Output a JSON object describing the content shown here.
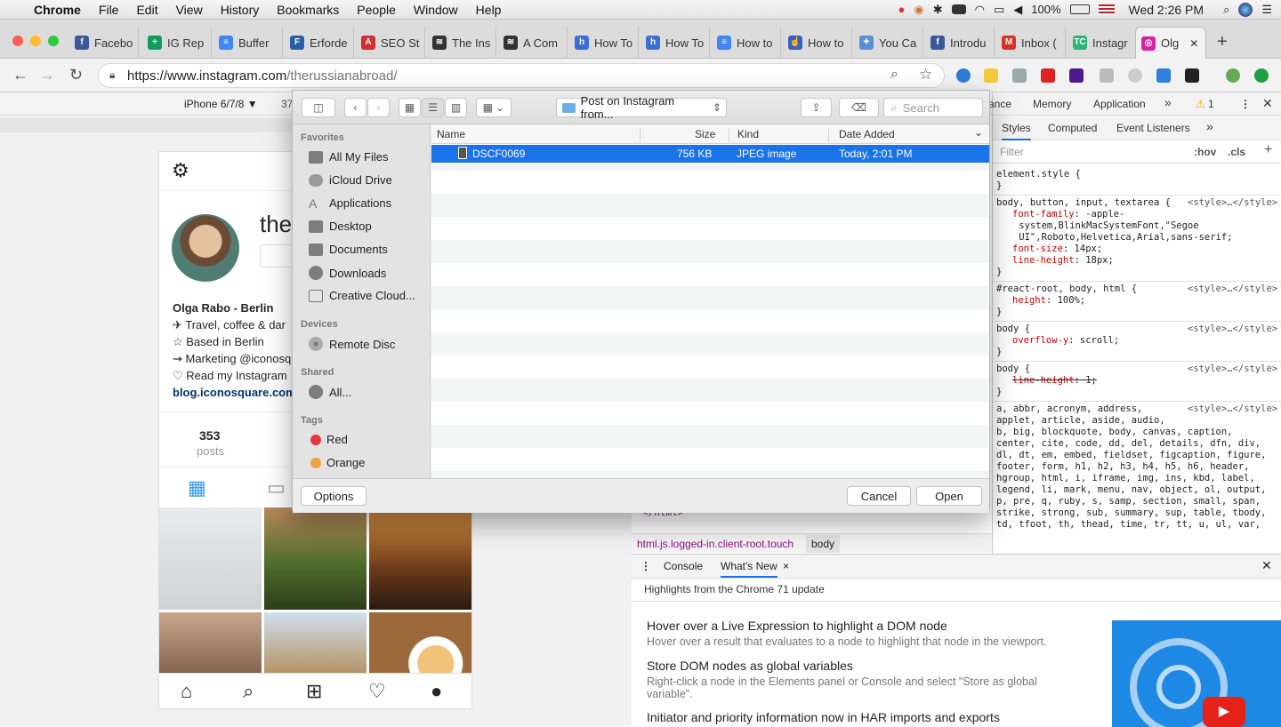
{
  "menubar": {
    "apple": "",
    "app": "Chrome",
    "items": [
      "File",
      "Edit",
      "View",
      "History",
      "Bookmarks",
      "People",
      "Window",
      "Help"
    ],
    "battery": "100%",
    "clock": "Wed 2:26 PM"
  },
  "tabs": [
    {
      "title": "Facebo",
      "color": "#3b5998",
      "glyph": "f"
    },
    {
      "title": "IG Rep",
      "color": "#0f9d58",
      "glyph": "+"
    },
    {
      "title": "Buffer",
      "color": "#4285f4",
      "glyph": "≡"
    },
    {
      "title": "Erforde",
      "color": "#2a5fa8",
      "glyph": "F"
    },
    {
      "title": "SEO St",
      "color": "#d32f2f",
      "glyph": "A"
    },
    {
      "title": "The Ins",
      "color": "#333333",
      "glyph": "≋"
    },
    {
      "title": "A Com",
      "color": "#333333",
      "glyph": "≋"
    },
    {
      "title": "How To",
      "color": "#3b6fd6",
      "glyph": "h"
    },
    {
      "title": "How To",
      "color": "#3b6fd6",
      "glyph": "h"
    },
    {
      "title": "How to",
      "color": "#4285f4",
      "glyph": "≡"
    },
    {
      "title": "How to",
      "color": "#3a5fbf",
      "glyph": "☝"
    },
    {
      "title": "You Ca",
      "color": "#5a8fd6",
      "glyph": "✦"
    },
    {
      "title": "Introdu",
      "color": "#3b5998",
      "glyph": "f"
    },
    {
      "title": "Inbox (",
      "color": "#d93025",
      "glyph": "M"
    },
    {
      "title": "Instagr",
      "color": "#2bb673",
      "glyph": "TC"
    },
    {
      "title": "Olg",
      "color": "#d6249f",
      "glyph": "◎",
      "active": true
    }
  ],
  "url": {
    "host": "https://www.instagram.com",
    "path": "/therussianabroad/"
  },
  "device_toolbar": {
    "device": "iPhone 6/7/8 ▼",
    "width": "37"
  },
  "instagram": {
    "name_partial": "the",
    "bio_name": "Olga Rabo - Berlin",
    "bio_lines": [
      "✈ Travel, coffee & dar",
      "☆ Based in Berlin",
      "⇝ Marketing @iconosq",
      "♡ Read my Instagram"
    ],
    "bio_mention": "@iconosq",
    "bio_link": "blog.iconosquare.com",
    "posts_count": "353",
    "posts_label": "posts"
  },
  "dialog": {
    "location": "Post on Instagram from...",
    "search_placeholder": "Search",
    "sidebar": {
      "favorites_head": "Favorites",
      "favorites": [
        "All My Files",
        "iCloud Drive",
        "Applications",
        "Desktop",
        "Documents",
        "Downloads",
        "Creative Cloud..."
      ],
      "devices_head": "Devices",
      "devices": [
        "Remote Disc"
      ],
      "shared_head": "Shared",
      "shared": [
        "All..."
      ],
      "tags_head": "Tags",
      "tags": [
        {
          "name": "Red",
          "color": "#e5383b"
        },
        {
          "name": "Orange",
          "color": "#f4a23b"
        }
      ]
    },
    "columns": {
      "name": "Name",
      "size": "Size",
      "kind": "Kind",
      "date": "Date Added"
    },
    "files": [
      {
        "name": "DSCF0069",
        "size": "756 KB",
        "kind": "JPEG image",
        "date": "Today, 2:01 PM"
      }
    ],
    "options_btn": "Options",
    "cancel_btn": "Cancel",
    "open_btn": "Open"
  },
  "devtools": {
    "top_tabs": [
      "ance",
      "Memory",
      "Application",
      "»"
    ],
    "warnings": "1",
    "sub_tabs": [
      "Styles",
      "Computed",
      "Event Listeners",
      "»"
    ],
    "filter_placeholder": "Filter",
    "hov": ":hov",
    "cls": ".cls",
    "breadcrumb": [
      "html.js.logged-in.client-root.touch",
      "body"
    ],
    "html_tail": "</html>",
    "rules": [
      {
        "selector": "element.style {",
        "src": "",
        "props": [],
        "close": "}"
      },
      {
        "selector": "body, button, input, textarea {",
        "src": "<style>…</style>",
        "props": [
          [
            "font-family",
            " -apple-"
          ],
          [
            "",
            "    system,BlinkMacSystemFont,\"Segoe"
          ],
          [
            "",
            "    UI\",Roboto,Helvetica,Arial,sans-serif;"
          ],
          [
            "font-size",
            " 14px;"
          ],
          [
            "line-height",
            " 18px;"
          ]
        ],
        "close": "}"
      },
      {
        "selector": "#react-root, body, html {",
        "src": "<style>…</style>",
        "props": [
          [
            "height",
            " 100%;"
          ]
        ],
        "close": "}"
      },
      {
        "selector": "body {",
        "src": "<style>…</style>",
        "props": [
          [
            "overflow-y",
            " scroll;"
          ]
        ],
        "close": "}"
      },
      {
        "selector": "body {",
        "src": "<style>…</style>",
        "props": [
          [
            "line-height",
            " 1;"
          ]
        ],
        "close": "}"
      }
    ],
    "reset_rule": {
      "src": "<style>…</style>",
      "lines": [
        "a, abbr, acronym, address,",
        "applet, article, aside, audio,",
        "b, big, blockquote, body, canvas, caption,",
        "center, cite, code, dd, del, details, dfn, div,",
        "dl, dt, em, embed, fieldset, figcaption, figure,",
        "footer, form, h1, h2, h3, h4, h5, h6, header,",
        "hgroup, html, i, iframe, img, ins, kbd, label,",
        "legend, li, mark, menu, nav, object, ol, output,",
        "p, pre, q, ruby, s, samp, section, small, span,",
        "strike, strong, sub, summary, sup, table, tbody,",
        "td, tfoot, th, thead, time, tr, tt, u, ul, var,"
      ]
    },
    "drawer": {
      "tabs": [
        "Console",
        "What's New"
      ],
      "highlights_title": "Highlights from the Chrome 71 update",
      "items": [
        {
          "title": "Hover over a Live Expression to highlight a DOM node",
          "desc": "Hover over a result that evaluates to a node to highlight that node in the viewport."
        },
        {
          "title": "Store DOM nodes as global variables",
          "desc": "Right-click a node in the Elements panel or Console and select \"Store as global variable\"."
        },
        {
          "title": "Initiator and priority information now in HAR imports and exports",
          "desc": ""
        }
      ]
    }
  }
}
